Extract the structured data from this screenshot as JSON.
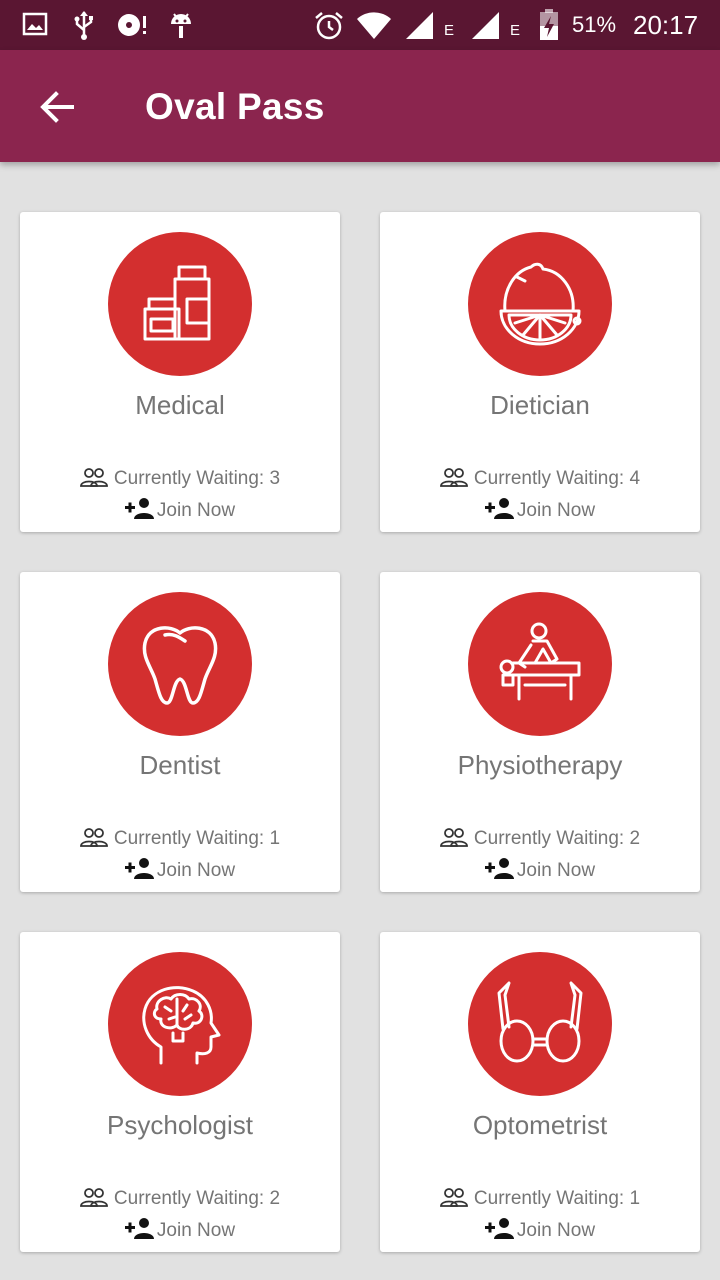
{
  "status_bar": {
    "battery_percent": "51%",
    "time": "20:17",
    "network_type_1": "E",
    "network_type_2": "E"
  },
  "app_bar": {
    "title": "Oval Pass",
    "back_icon": "arrow-back-icon"
  },
  "colors": {
    "status_bar": "#5a1632",
    "app_bar": "#8b254e",
    "icon_circle": "#d32f2f",
    "background": "#e1e1e1"
  },
  "categories": [
    {
      "name": "Medical",
      "waiting_label": "Currently Waiting: 3",
      "join_label": "Join Now",
      "icon": "medicine-bottles-icon"
    },
    {
      "name": "Dietician",
      "waiting_label": "Currently Waiting: 4",
      "join_label": "Join Now",
      "icon": "lemon-icon"
    },
    {
      "name": "Dentist",
      "waiting_label": "Currently Waiting: 1",
      "join_label": "Join Now",
      "icon": "tooth-icon"
    },
    {
      "name": "Physiotherapy",
      "waiting_label": "Currently Waiting: 2",
      "join_label": "Join Now",
      "icon": "massage-icon"
    },
    {
      "name": "Psychologist",
      "waiting_label": "Currently Waiting: 2",
      "join_label": "Join Now",
      "icon": "brain-head-icon"
    },
    {
      "name": "Optometrist",
      "waiting_label": "Currently Waiting: 1",
      "join_label": "Join Now",
      "icon": "glasses-icon"
    }
  ]
}
